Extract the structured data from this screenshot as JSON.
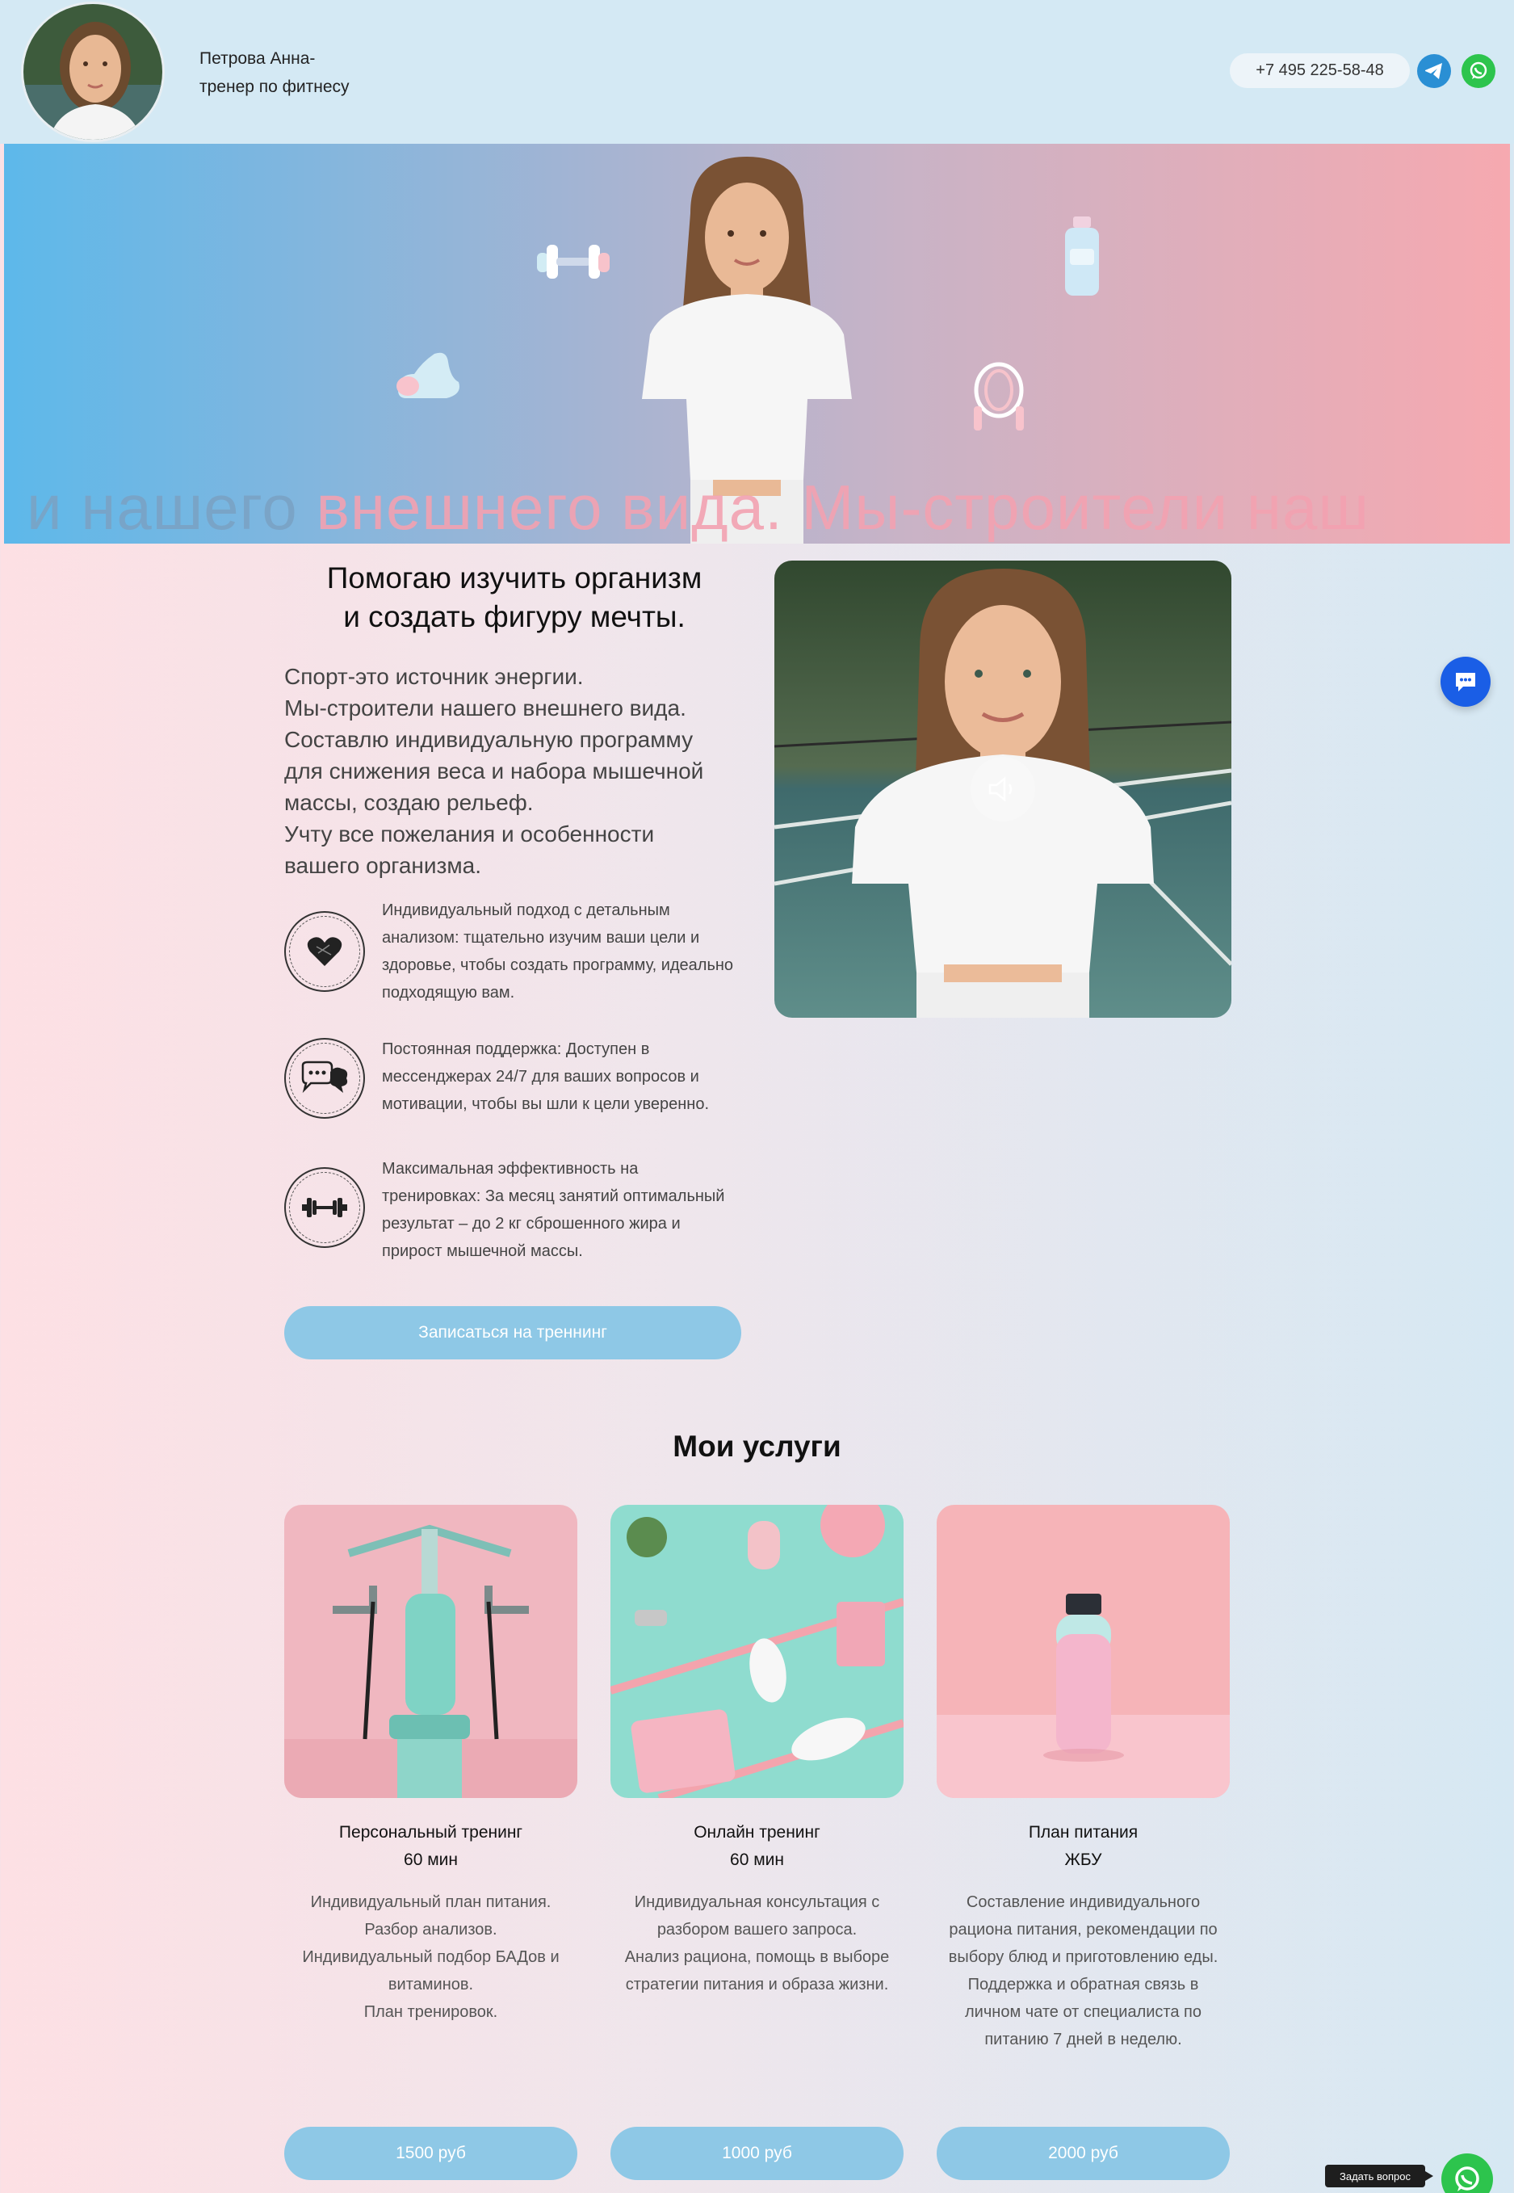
{
  "header": {
    "name_line1": "Петрова Анна-",
    "name_line2": "тренер по фитнесу",
    "phone": "+7 495 225-58-48"
  },
  "hero": {
    "marquee_part1": "и нашего ",
    "marquee_part2": "внешнего вида.",
    "marquee_part3": "  Мы-строители наш"
  },
  "intro": {
    "title_line1": "Помогаю изучить организм",
    "title_line2": "и создать фигуру мечты.",
    "text_lines": [
      "Спорт-это источник энергии.",
      "Мы-строители нашего внешнего вида.",
      "Составлю индивидуальную программу",
      "для снижения веса и набора мышечной",
      "массы, создаю рельеф.",
      "Учту все пожелания и особенности",
      "вашего организма."
    ],
    "features": [
      {
        "icon": "heart-icon",
        "text": "Индивидуальный подход с детальным анализом: тщательно изучим ваши цели и здоровье, чтобы создать программу, идеально подходящую вам."
      },
      {
        "icon": "chat-bubbles-icon",
        "text": "Постоянная поддержка: Доступен в мессенджерах 24/7 для ваших вопросов и мотивации, чтобы вы шли к цели уверенно."
      },
      {
        "icon": "dumbbell-icon",
        "text": "Максимальная эффективность на тренировках: За месяц занятий оптимальный результат – до 2 кг сброшенного жира и прирост мышечной массы."
      }
    ],
    "cta_label": "Записаться на треннинг"
  },
  "services": {
    "title": "Мои услуги",
    "cards": [
      {
        "name": "Персональный тренинг",
        "duration": "60 мин",
        "desc": [
          "Индивидуальный план питания.",
          "Разбор анализов.",
          "Индивидуальный подбор БАДов и",
          "витаминов.",
          "План тренировок."
        ],
        "price": "1500 руб"
      },
      {
        "name": "Онлайн тренинг",
        "duration": "60 мин",
        "desc": [
          "Индивидуальная консультация с",
          "разбором вашего запроса.",
          "Анализ рациона, помощь в выборе",
          "стратегии питания и образа жизни."
        ],
        "price": "1000 руб"
      },
      {
        "name": "План питания",
        "duration": "ЖБУ",
        "desc": [
          "Составление индивидуального",
          "рациона питания, рекомендации по",
          "выбору блюд и приготовлению еды.",
          "Поддержка и обратная связь в",
          "личном чате от специалиста по",
          "питанию 7 дней в неделю."
        ],
        "price": "2000 руб"
      }
    ]
  },
  "widgets": {
    "ask_label": "Задать вопрос"
  },
  "colors": {
    "accent_button": "#8ec8e6",
    "header_bg": "#d4e9f4",
    "marquee_pink": "#f3a2b1",
    "whatsapp": "#2dc44d",
    "telegram": "#2a8fd4",
    "chat_widget": "#1a5ee6"
  }
}
